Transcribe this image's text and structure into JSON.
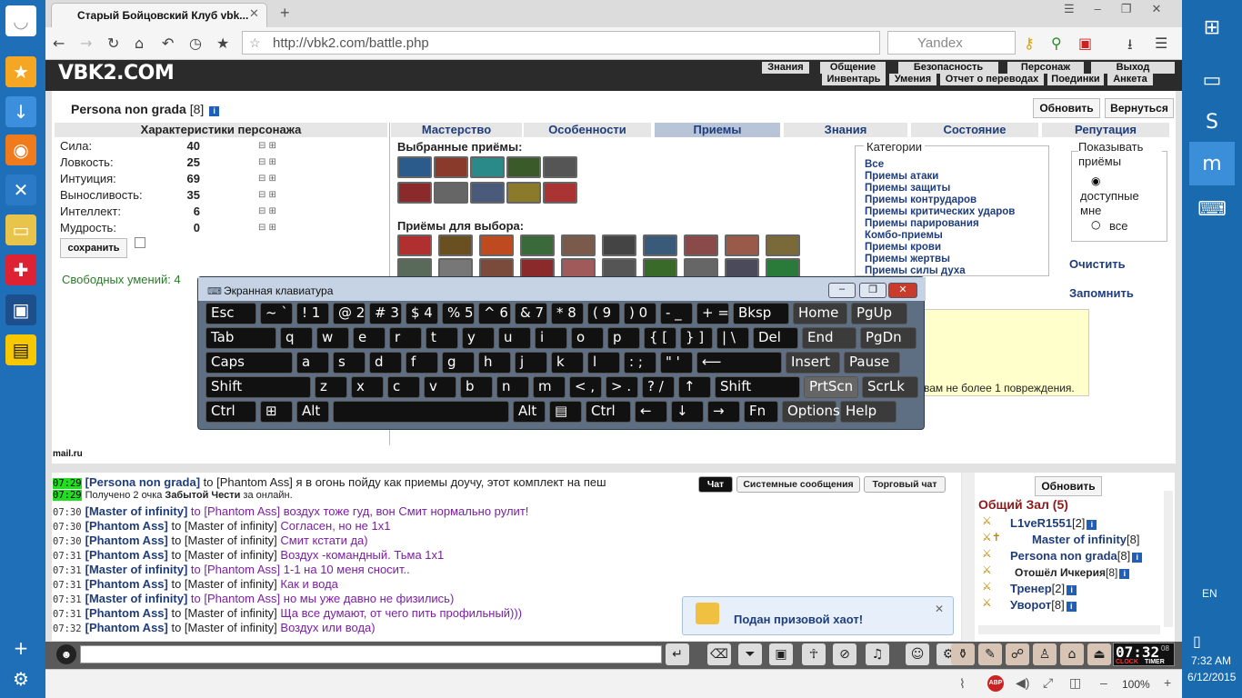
{
  "browser": {
    "tab_title": "Старый Бойцовский Клуб vbk...",
    "url": "http://vbk2.com/battle.php",
    "search_placeholder": "Yandex",
    "zoom": "100%"
  },
  "site": {
    "logo": "VBK2.COM",
    "menu_top": [
      "Знания",
      "Общение",
      "Безопасность",
      "Персонаж",
      "Выход"
    ],
    "menu_bottom": [
      "Инвентарь",
      "Умения",
      "Отчет о переводах",
      "Поединки",
      "Анкета"
    ]
  },
  "character": {
    "name": "Persona non grada",
    "level": "[8]",
    "refresh_label": "Обновить",
    "back_label": "Вернуться",
    "section_title": "Характеристики персонажа",
    "stats": [
      {
        "label": "Сила:",
        "value": "40"
      },
      {
        "label": "Ловкость:",
        "value": "25"
      },
      {
        "label": "Интуиция:",
        "value": "69"
      },
      {
        "label": "Выносливость:",
        "value": "35"
      },
      {
        "label": "Интеллект:",
        "value": "6"
      },
      {
        "label": "Мудрость:",
        "value": "0"
      }
    ],
    "save_label": "сохранить",
    "free_skills": "Свободных умений: 4"
  },
  "tabs": [
    "Мастерство",
    "Особенности",
    "Приемы",
    "Знания",
    "Состояние",
    "Репутация"
  ],
  "skills": {
    "selected_title": "Выбранные приёмы:",
    "available_title": "Приёмы для выбора:",
    "categories_title": "Категории",
    "categories": [
      "Все",
      "Приемы атаки",
      "Приемы защиты",
      "Приемы контрударов",
      "Приемы критических ударов",
      "Приемы парирования",
      "Комбо-приемы",
      "Приемы крови",
      "Приемы жертвы",
      "Приемы силы духа"
    ],
    "show_title": "Показывать приёмы",
    "show_opt1": "доступные мне",
    "show_opt2": "все",
    "clear_label": "Очистить",
    "remember_label": "Запомнить",
    "hint_text": "вам не более 1 повреждения."
  },
  "keyboard": {
    "title": "Экранная клавиатура",
    "rows": [
      [
        "Esc",
        "~ `",
        "! 1",
        "@ 2",
        "# 3",
        "$ 4",
        "% 5",
        "^ 6",
        "& 7",
        "* 8",
        "( 9",
        ") 0",
        "- _",
        "+ =",
        "Bksp",
        "Home",
        "PgUp"
      ],
      [
        "Tab",
        "q",
        "w",
        "e",
        "r",
        "t",
        "y",
        "u",
        "i",
        "o",
        "p",
        "{ [",
        "} ]",
        "| \\",
        "Del",
        "End",
        "PgDn"
      ],
      [
        "Caps",
        "a",
        "s",
        "d",
        "f",
        "g",
        "h",
        "j",
        "k",
        "l",
        ": ;",
        "\" '",
        "⟵",
        "Insert",
        "Pause"
      ],
      [
        "Shift",
        "z",
        "x",
        "c",
        "v",
        "b",
        "n",
        "m",
        "< ,",
        "> .",
        "? /",
        "↑",
        "Shift",
        "PrtScn",
        "ScrLk"
      ],
      [
        "Ctrl",
        "⊞",
        "Alt",
        "",
        "Alt",
        "▤",
        "Ctrl",
        "←",
        "↓",
        "→",
        "Fn",
        "Options",
        "Help"
      ]
    ]
  },
  "chat": {
    "tabs": [
      "Чат",
      "Системные сообщения",
      "Торговый чат"
    ],
    "lines": [
      {
        "time": "07:29",
        "from": "[Persona non grada]",
        "to": " to [Phantom Ass] ",
        "msg": "я в огонь пойду как приемы доучу, этот комплект на пеш"
      },
      {
        "time": "07:29",
        "from": "",
        "to": "Получено 2 очка ",
        "msg": "Забытой Чести",
        "extra": " за онлайн."
      },
      {
        "time": "07:30",
        "from": "[Master of infinity]",
        "to": " to [Phantom Ass] ",
        "msg": "воздух тоже гуд, вон Смит нормально рулит!"
      },
      {
        "time": "07:30",
        "from": "[Phantom Ass]",
        "to": " to [Master of infinity] ",
        "msg": "Согласен, но не 1x1"
      },
      {
        "time": "07:30",
        "from": "[Phantom Ass]",
        "to": " to [Master of infinity] ",
        "msg": "Смит кстати да)"
      },
      {
        "time": "07:31",
        "from": "[Phantom Ass]",
        "to": " to [Master of infinity] ",
        "msg": "Воздух -командный. Тьма 1x1"
      },
      {
        "time": "07:31",
        "from": "[Master of infinity]",
        "to": " to [Phantom Ass] ",
        "msg": "1-1 на 10 меня сносит.."
      },
      {
        "time": "07:31",
        "from": "[Phantom Ass]",
        "to": " to [Master of infinity] ",
        "msg": "Как и вода"
      },
      {
        "time": "07:31",
        "from": "[Master of infinity]",
        "to": " to [Phantom Ass] ",
        "msg": "но мы уже давно не физились)"
      },
      {
        "time": "07:31",
        "from": "[Phantom Ass]",
        "to": " to [Master of infinity] ",
        "msg": "Ща все думают, от чего пить профильный)))"
      },
      {
        "time": "07:32",
        "from": "[Phantom Ass]",
        "to": " to [Master of infinity] ",
        "msg": "Воздух или вода)"
      }
    ]
  },
  "online": {
    "refresh_label": "Обновить",
    "room": "Общий Зал (5)",
    "users": [
      {
        "name": "L1veR1551",
        "lvl": "[2]"
      },
      {
        "name": "Master of infinity",
        "lvl": "[8]"
      },
      {
        "name": "Persona non grada",
        "lvl": "[8]"
      },
      {
        "name": "Отошёл Ичкерия",
        "lvl": "[8]"
      },
      {
        "name": "Тренер",
        "lvl": "[2]"
      },
      {
        "name": "Уворот",
        "lvl": "[8]"
      }
    ]
  },
  "notification": "Подан призовой хаот!",
  "clock": {
    "time": "07:32",
    "sec": "08",
    "label1": "CLOCK",
    "label2": "TIMER"
  },
  "taskbar": {
    "lang": "EN",
    "time": "7:32 AM",
    "date": "6/12/2015"
  },
  "mail": "mail.ru"
}
